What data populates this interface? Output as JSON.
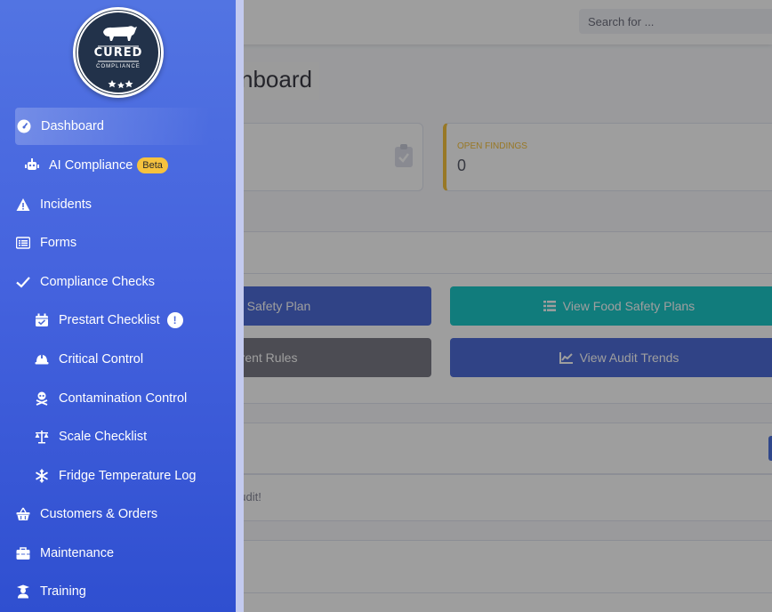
{
  "topbar": {
    "search_placeholder": "Search for ..."
  },
  "page": {
    "title": "Dashboard",
    "title_visible": "nboard"
  },
  "cards": [
    {
      "label": "OPEN FINDINGS",
      "value": "0",
      "accent": "#f6c23e"
    }
  ],
  "actions": [
    {
      "label": "Food Safety Plan",
      "visible": "d Safety Plan",
      "color": "#4e6cd8",
      "icon": "plus-icon"
    },
    {
      "label": "View Food Safety Plans",
      "color": "#1cc8c8",
      "icon": "list-icon"
    },
    {
      "label": "Current Rules",
      "visible": "rrent Rules",
      "color": "#7b7b86",
      "icon": "rules-icon"
    },
    {
      "label": "View Audit Trends",
      "color": "#4e6cd8",
      "icon": "chart-line-icon"
    }
  ],
  "audit_message": "audit!",
  "logo": {
    "title": "CURED",
    "subtitle": "COMPLIANCE"
  },
  "sidebar": {
    "items": [
      {
        "label": "Dashboard",
        "icon": "tachometer-icon",
        "active": true
      },
      {
        "label": "AI Compliance",
        "icon": "robot-icon",
        "badge": "Beta"
      },
      {
        "label": "Incidents",
        "icon": "warning-icon"
      },
      {
        "label": "Forms",
        "icon": "list-alt-icon"
      },
      {
        "label": "Compliance Checks",
        "icon": "check-icon"
      },
      {
        "label": "Prestart Checklist",
        "icon": "calendar-check-icon",
        "alert": "!"
      },
      {
        "label": "Critical Control",
        "icon": "hard-hat-icon"
      },
      {
        "label": "Contamination Control",
        "icon": "skull-crossbones-icon"
      },
      {
        "label": "Scale Checklist",
        "icon": "balance-scale-icon"
      },
      {
        "label": "Fridge Temperature Log",
        "icon": "snowflake-icon"
      },
      {
        "label": "Customers & Orders",
        "icon": "shopping-basket-icon"
      },
      {
        "label": "Maintenance",
        "icon": "toolbox-icon"
      },
      {
        "label": "Training",
        "icon": "user-graduate-icon"
      }
    ]
  }
}
